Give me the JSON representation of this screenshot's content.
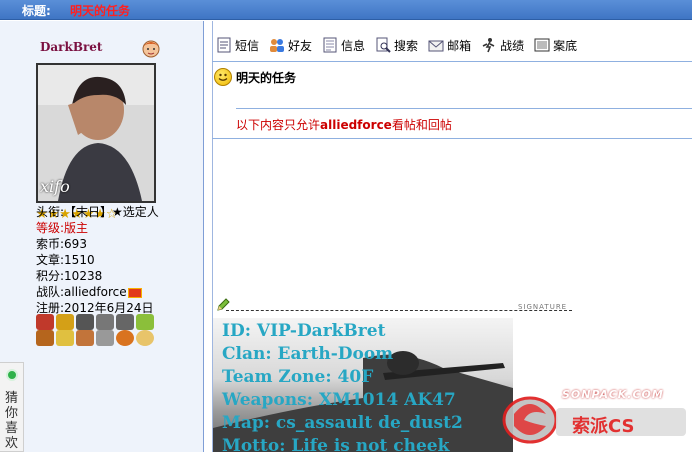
{
  "header": {
    "label": "标题:",
    "title": "明天的任务"
  },
  "user": {
    "name": "DarkBret",
    "avatar_caption": "xifo",
    "stars": "★★★★★★☆",
    "title_label": "头衔:",
    "title_value": "【末日】★选定人",
    "level_label": "等级:",
    "level_value": "版主",
    "coins_label": "索币:",
    "coins_value": "693",
    "posts_label": "文章:",
    "posts_value": "1510",
    "points_label": "积分:",
    "points_value": "10238",
    "team_label": "战队:",
    "team_value": "alliedforce",
    "reg_label": "注册:",
    "reg_value": "2012年6月24日"
  },
  "toolbar": [
    {
      "label": "短信",
      "icon": "sms-icon"
    },
    {
      "label": "好友",
      "icon": "friends-icon"
    },
    {
      "label": "信息",
      "icon": "info-icon"
    },
    {
      "label": "搜索",
      "icon": "search-icon"
    },
    {
      "label": "邮箱",
      "icon": "mail-icon"
    },
    {
      "label": "战绩",
      "icon": "record-icon"
    },
    {
      "label": "案底",
      "icon": "file-icon"
    }
  ],
  "post": {
    "title": "明天的任务",
    "restrict_prefix": "以下内容只允许",
    "restrict_team": "alliedforce",
    "restrict_suffix": "看帖和回帖"
  },
  "signature": {
    "label": "SIGNATURE",
    "lines": [
      "ID: VIP-DarkBret",
      "Clan: Earth-Doom",
      "Team Zone: 40F",
      "Weapons: XM1014  AK47",
      "Map: cs_assault  de_dust2",
      "Motto: Life is not cheek"
    ]
  },
  "watermark": {
    "line1": "SONPACK.COM",
    "line2": "索派CS"
  },
  "side_tab": {
    "text": "猜你喜欢"
  },
  "colors": {
    "header_bg": "#3f75c4",
    "title_red": "#ff2020",
    "sig_text": "#27a7c4"
  }
}
